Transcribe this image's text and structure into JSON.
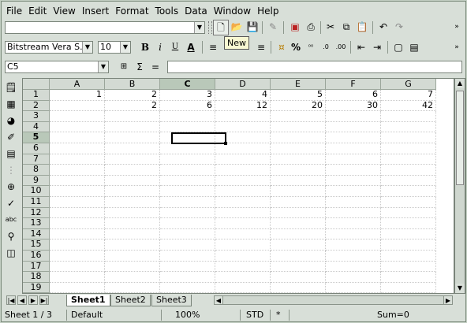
{
  "menu": [
    "File",
    "Edit",
    "View",
    "Insert",
    "Format",
    "Tools",
    "Data",
    "Window",
    "Help"
  ],
  "menu_mnemonics": [
    "F",
    "E",
    "V",
    "I",
    "o",
    "T",
    "D",
    "W",
    "H"
  ],
  "toolbar": {
    "url_value": "",
    "tooltip": "New"
  },
  "format": {
    "font_name": "Bitstream Vera S...",
    "font_size": "10",
    "bold_label": "B",
    "italic_label": "i",
    "underline_label": "U"
  },
  "formula": {
    "cell_ref": "C5",
    "sigma": "Σ",
    "equals": "=",
    "content": ""
  },
  "grid": {
    "columns": [
      "A",
      "B",
      "C",
      "D",
      "E",
      "F",
      "G"
    ],
    "selected_column": "C",
    "rows": [
      "1",
      "2",
      "3",
      "4",
      "5",
      "6",
      "7",
      "8",
      "9",
      "10",
      "11",
      "12",
      "13",
      "14",
      "15",
      "16",
      "17",
      "18",
      "19"
    ],
    "selected_row": "5",
    "data": [
      [
        "1",
        "2",
        "3",
        "4",
        "5",
        "6",
        "7"
      ],
      [
        "",
        "2",
        "6",
        "12",
        "20",
        "30",
        "42"
      ]
    ]
  },
  "sheets": [
    "Sheet1",
    "Sheet2",
    "Sheet3"
  ],
  "active_sheet": "Sheet1",
  "status": {
    "sheet": "Sheet 1 / 3",
    "style": "Default",
    "zoom": "100%",
    "mode": "STD",
    "modified": "*",
    "sum": "Sum=0"
  }
}
